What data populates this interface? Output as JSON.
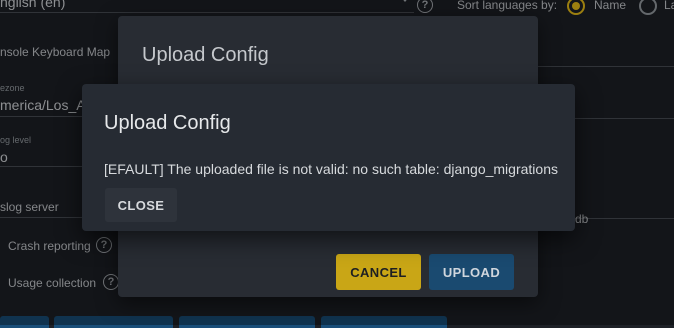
{
  "background": {
    "language_value": "nglish (en)",
    "sort_label": "Sort languages by:",
    "sort_option_name": "Name",
    "sort_option_other": "La",
    "console_keyboard_label": "nsole Keyboard Map",
    "timezone_label": "ezone",
    "timezone_value": "merica/Los_A",
    "log_level_label": "og level",
    "log_level_value": "o",
    "syslog_label": "slog server",
    "db_text": "db",
    "crash_reporting": "Crash reporting",
    "usage_collection": "Usage collection"
  },
  "upload_dialog": {
    "title": "Upload Config",
    "cancel_label": "CANCEL",
    "upload_label": "UPLOAD"
  },
  "error_dialog": {
    "title": "Upload Config",
    "message": "[EFAULT] The uploaded file is not valid: no such table: django_migrations",
    "close_label": "CLOSE"
  },
  "colors": {
    "accent_yellow": "#c9a616",
    "primary_blue": "#1a4a70",
    "dialog_bg": "#262b33"
  }
}
